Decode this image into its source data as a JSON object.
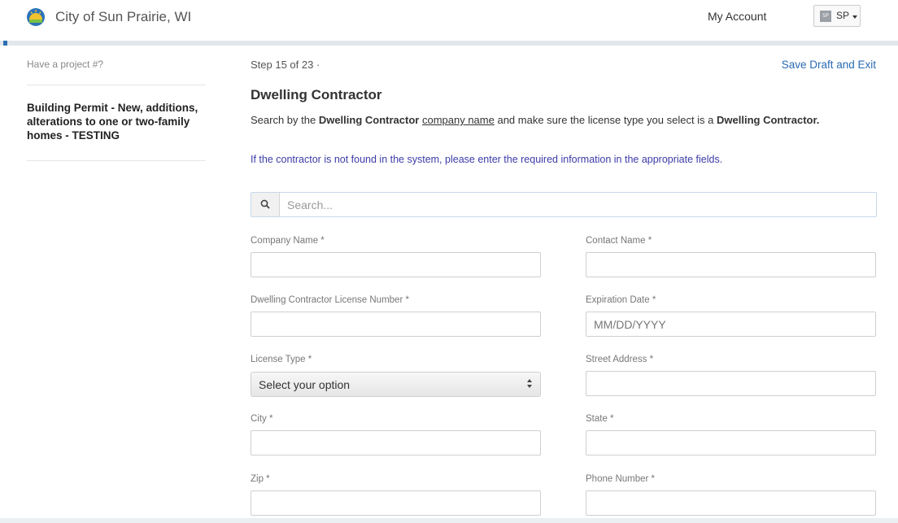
{
  "header": {
    "city_name": "City of Sun Prairie, WI",
    "my_account": "My Account",
    "user_initials": "SP",
    "user_avatar_text": "SP"
  },
  "sidebar": {
    "have_project": "Have a project #?",
    "permit_title": "Building Permit - New, additions, alterations to one or two-family homes - TESTING"
  },
  "main": {
    "step": "Step 15 of 23 ·",
    "save_draft": "Save Draft and Exit",
    "section_title": "Dwelling Contractor",
    "instructions": {
      "part1": "Search by the ",
      "bold1": "Dwelling Contractor",
      "part2": " ",
      "underline": "company name",
      "part3": " and make sure the license type you select is a ",
      "bold2": "Dwelling Contractor."
    },
    "notice": "If the contractor is not found in the system, please enter the required information in the appropriate fields.",
    "search_placeholder": "Search...",
    "fields": {
      "company_name": {
        "label": "Company Name *",
        "value": ""
      },
      "contact_name": {
        "label": "Contact Name *",
        "value": ""
      },
      "license_number": {
        "label": "Dwelling Contractor License Number *",
        "value": ""
      },
      "expiration_date": {
        "label": "Expiration Date *",
        "placeholder": "MM/DD/YYYY"
      },
      "license_type": {
        "label": "License Type *",
        "selected": "Select your option"
      },
      "street_address": {
        "label": "Street Address *",
        "value": ""
      },
      "city": {
        "label": "City *",
        "value": ""
      },
      "state": {
        "label": "State *",
        "value": ""
      },
      "zip": {
        "label": "Zip *",
        "value": ""
      },
      "phone": {
        "label": "Phone Number *",
        "value": ""
      }
    }
  },
  "colors": {
    "link": "#2a6ab4",
    "notice": "#3b3ba8",
    "accent": "#2f6fb3"
  },
  "icons": {
    "logo": "sun-prairie-logo",
    "search": "search-icon",
    "caret": "chevron-down-icon",
    "select_arrows": "select-arrows-icon"
  }
}
